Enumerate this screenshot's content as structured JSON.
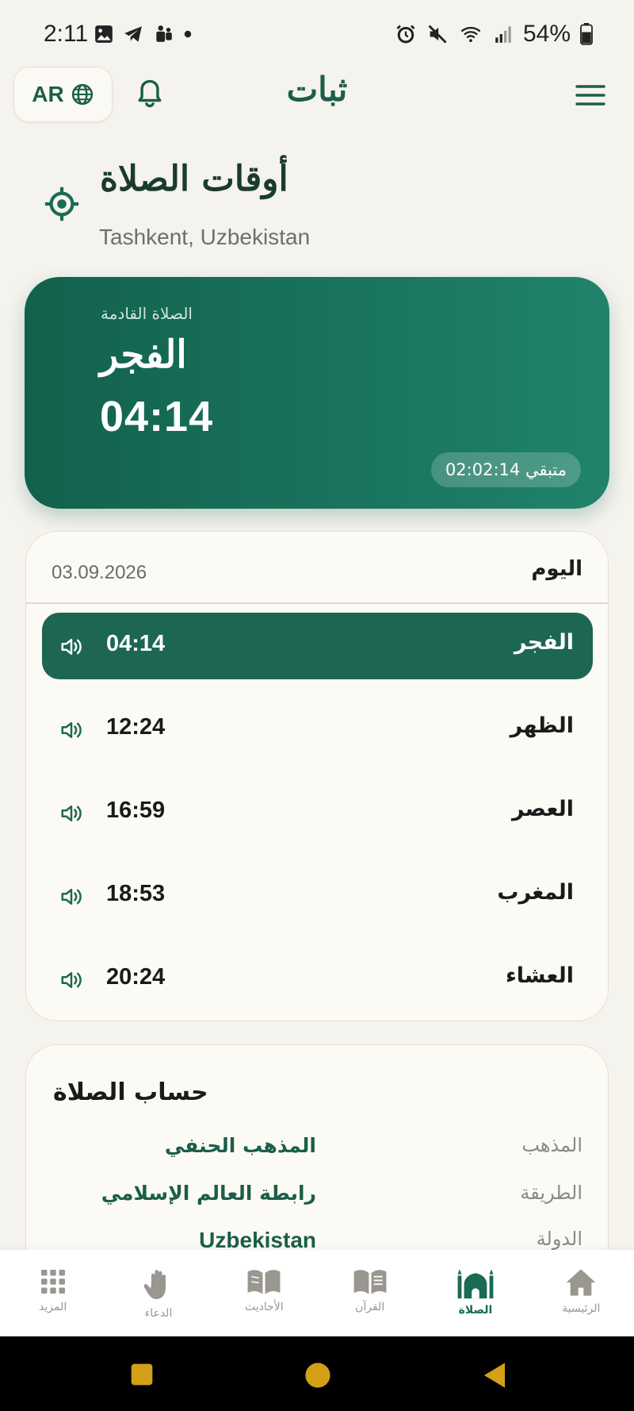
{
  "status_bar": {
    "time": "2:11",
    "battery": "54%"
  },
  "header": {
    "language": "AR",
    "app_title": "ثبات"
  },
  "page": {
    "title": "أوقات الصلاة",
    "location": "Tashkent, Uzbekistan"
  },
  "next_prayer": {
    "label": "الصلاة القادمة",
    "name": "الفجر",
    "time": "04:14",
    "remaining": "02:02:14 متبقي"
  },
  "times": {
    "date": "03.09.2026",
    "today_label": "اليوم",
    "prayers": [
      {
        "name": "الفجر",
        "time": "04:14"
      },
      {
        "name": "الظهر",
        "time": "12:24"
      },
      {
        "name": "العصر",
        "time": "16:59"
      },
      {
        "name": "المغرب",
        "time": "18:53"
      },
      {
        "name": "العشاء",
        "time": "20:24"
      }
    ]
  },
  "calculation": {
    "title": "حساب الصلاة",
    "rows": [
      {
        "label": "المذهب",
        "value": "المذهب الحنفي"
      },
      {
        "label": "الطريقة",
        "value": "رابطة العالم الإسلامي"
      },
      {
        "label": "الدولة",
        "value": "Uzbekistan"
      }
    ]
  },
  "bottom_nav": {
    "items": [
      {
        "label": "المزيد",
        "icon": "grid-icon"
      },
      {
        "label": "الدعاء",
        "icon": "hand-icon"
      },
      {
        "label": "الأحاديث",
        "icon": "open-book-icon"
      },
      {
        "label": "القرآن",
        "icon": "quran-book-icon"
      },
      {
        "label": "الصلاة",
        "icon": "mosque-icon"
      },
      {
        "label": "الرئيسية",
        "icon": "home-icon"
      }
    ]
  },
  "colors": {
    "primary": "#1b5e4a",
    "active_row": "#1d6652",
    "background": "#f5f3ee",
    "nav_system": "#d4a017"
  }
}
